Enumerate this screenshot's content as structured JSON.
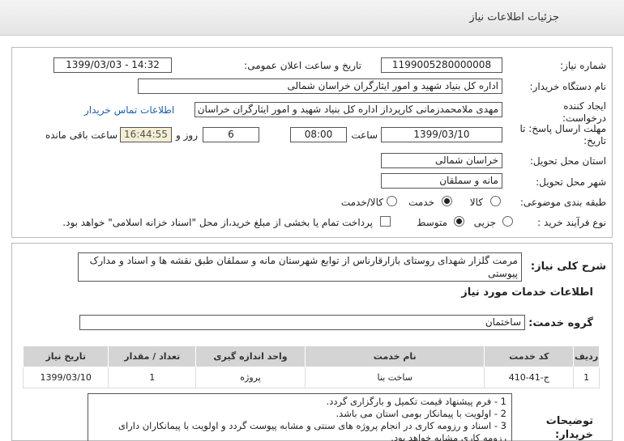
{
  "header": {
    "title": "جزئیات اطلاعات نیاز"
  },
  "form": {
    "need_number_label": "شماره نیاز:",
    "need_number": "1199005280000008",
    "announce_label": "تاریخ و ساعت اعلان عمومی:",
    "announce_value": "1399/03/03 - 14:32",
    "buyer_label": "نام دستگاه خریدار:",
    "buyer_value": "اداره کل بنیاد شهید و امور ایثارگران خراسان شمالی",
    "creator_label": "ایجاد کننده درخواست:",
    "creator_value": "مهدی  ملامحمدزمانی کارپرداز اداره کل بنیاد شهید و امور ایثارگران خراسان شم",
    "contact_link": "اطلاعات تماس خریدار",
    "deadline_label": "مهلت ارسال پاسخ: تا تاریخ:",
    "deadline_date": "1399/03/10",
    "hour_label": "ساعت",
    "deadline_hour": "08:00",
    "days_value": "6",
    "days_label": "روز و",
    "remaining_time": "16:44:55",
    "remaining_label": "ساعت باقی مانده",
    "province_label": "استان محل تحویل:",
    "province_value": "خراسان شمالی",
    "city_label": "شهر محل تحویل:",
    "city_value": "مانه و سملقان",
    "category_label": "طبقه بندی موضوعی:",
    "category_options": [
      "کالا",
      "خدمت",
      "کالا/خدمت"
    ],
    "category_selected": "خدمت",
    "process_label": "نوع فرآیند خرید :",
    "process_options": [
      "جزیی",
      "متوسط"
    ],
    "process_selected": "متوسط",
    "payment_text": "پرداخت تمام یا بخشی از مبلغ خرید،از محل \"اسناد خزانه اسلامی\" خواهد بود."
  },
  "summary": {
    "label": "شرح کلی نیاز:",
    "text": "مرمت گلزار شهدای روستای بازارقارناس از توابع شهرستان مانه و سملقان طبق نقشه ها و اسناد و مدارک پیوستی"
  },
  "services": {
    "section_title": "اطلاعات خدمات مورد نیاز",
    "group_label": "گروه خدمت:",
    "group_value": "ساختمان",
    "columns": [
      "ردیف",
      "کد خدمت",
      "نام خدمت",
      "واحد اندازه گیری",
      "تعداد / مقدار",
      "تاریخ نیاز"
    ],
    "rows": [
      [
        "1",
        "ج-41-410",
        "ساخت بنا",
        "پروژه",
        "1",
        "1399/03/10"
      ]
    ]
  },
  "notes": {
    "label": "توضیحات خریدار:",
    "lines": [
      "1 - فرم پیشنهاد قیمت تکمیل و بارگزاری گردد.",
      "2 - اولویت با پیمانکار بومی استان می باشد.",
      "3 - اسناد و رزومه کاری در انجام پروژه های سنتی و مشابه پیوست گردد و اولویت با پیمانکاران دارای",
      "رزومه کاری مشابه خواهد بود."
    ]
  }
}
